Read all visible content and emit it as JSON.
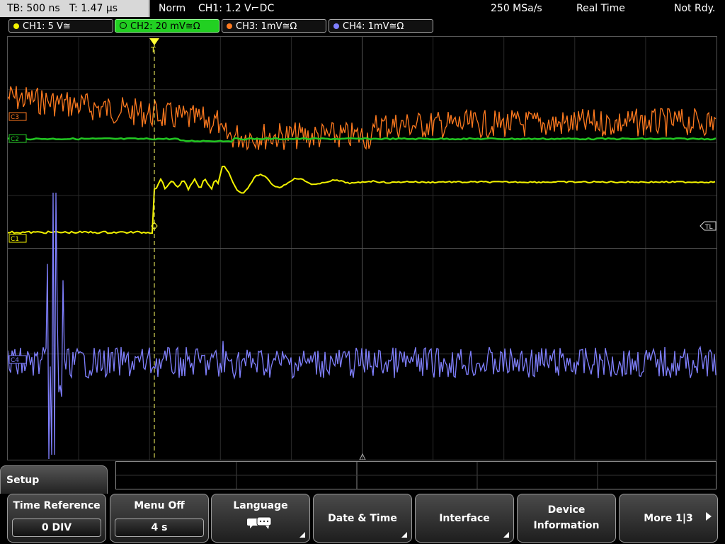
{
  "status_bar": {
    "timebase": "TB: 500 ns",
    "trigger_time": "T: 1.47 µs",
    "trigger_mode": "Norm",
    "trigger_info": "CH1: 1.2 V",
    "trigger_coupling": "DC",
    "sample_rate": "250 MSa/s",
    "acq_mode": "Real Time",
    "state": "Not Rdy."
  },
  "channels": [
    {
      "id": "CH1",
      "label": "CH1: 5 V≅",
      "color": "#f2f200",
      "active": false
    },
    {
      "id": "CH2",
      "label": "CH2: 20 mV≅Ω",
      "color": "#22c922",
      "active": true
    },
    {
      "id": "CH3",
      "label": "CH3: 1mV≅Ω",
      "color": "#ff7a1f",
      "active": false
    },
    {
      "id": "CH4",
      "label": "CH4: 1mV≅Ω",
      "color": "#8080ff",
      "active": false
    }
  ],
  "markers": {
    "ch1": "C1",
    "ch2": "C2",
    "ch3": "C3",
    "ch4": "C4",
    "trigger_level": "TL",
    "trigger_pos": "T"
  },
  "menu": {
    "title": "Setup",
    "softkeys": [
      {
        "label": "Time Reference",
        "value": "0 DIV"
      },
      {
        "label": "Menu Off",
        "value": "4 s"
      },
      {
        "label": "Language",
        "icon": "speech-bubbles-icon"
      },
      {
        "label": "Date & Time"
      },
      {
        "label": "Interface"
      },
      {
        "label1": "Device",
        "label2": "Information"
      },
      {
        "label": "More 1|3"
      }
    ]
  }
}
